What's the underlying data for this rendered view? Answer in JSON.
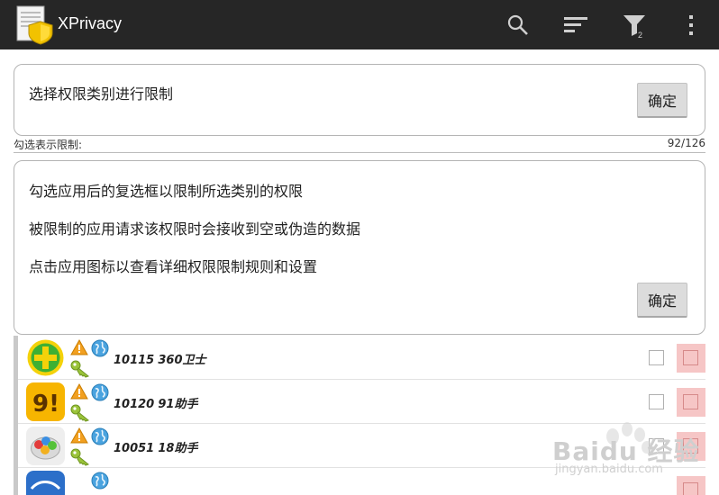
{
  "actionbar": {
    "title": "XPrivacy",
    "filter_count": "2",
    "icons": [
      "xprivacy-logo-icon",
      "search-icon",
      "sort-icon",
      "filter-icon",
      "overflow-menu-icon"
    ]
  },
  "category_card": {
    "text": "选择权限类别进行限制",
    "ok_label": "确定"
  },
  "hint": {
    "label": "勾选表示限制:",
    "count": "92/126"
  },
  "info_card": {
    "line1": "勾选应用后的复选框以限制所选类别的权限",
    "line2": "被限制的应用请求该权限时会接收到空或伪造的数据",
    "line3": "点击应用图标以查看详细权限限制规则和设置",
    "ok_label": "确定"
  },
  "apps": [
    {
      "uid": "10115",
      "name": "360卫士",
      "checked": false,
      "restricted": false
    },
    {
      "uid": "10120",
      "name": "91助手",
      "checked": false,
      "restricted": false
    },
    {
      "uid": "10051",
      "name": "18助手",
      "checked": false,
      "restricted": false
    }
  ],
  "colors": {
    "actionbar_bg": "#262626",
    "restrict_cell": "#f6c6c6",
    "button_bg": "#dcdcdc"
  },
  "watermark": {
    "brand": "Baidu 经验",
    "url": "jingyan.baidu.com"
  }
}
